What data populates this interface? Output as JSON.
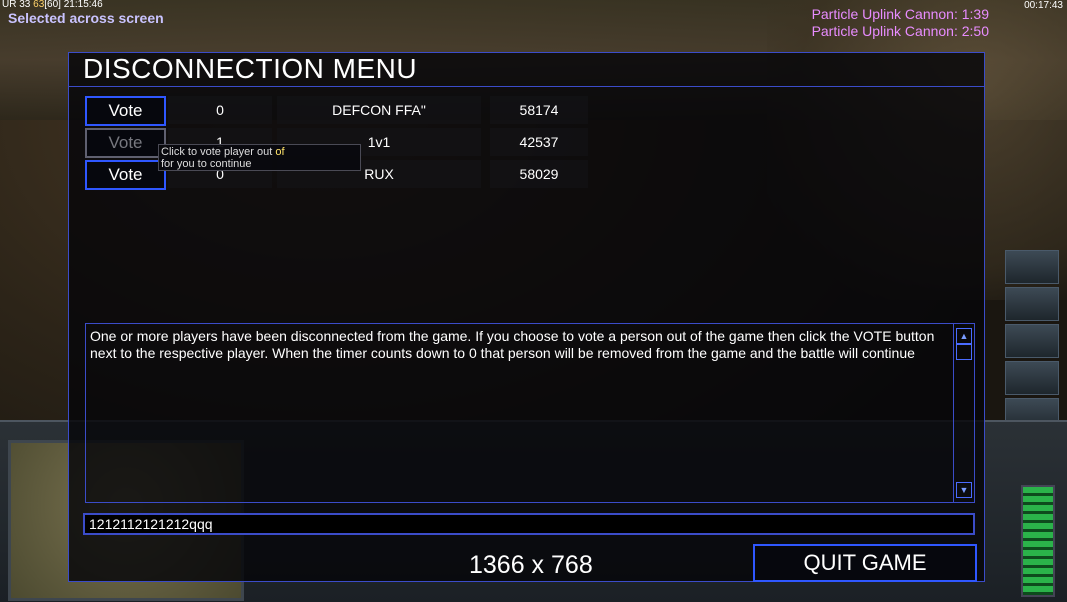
{
  "hud": {
    "stats_label": "UR",
    "stats_a": "33",
    "stats_b": "63",
    "stats_c": "[60]",
    "time": "21:15:46",
    "selection_text": "Selected across screen",
    "clock": "00:17:43",
    "timers": [
      "Particle Uplink Cannon: 1:39",
      "Particle Uplink Cannon: 2:50"
    ]
  },
  "dialog": {
    "title": "DISCONNECTION MENU",
    "players": [
      {
        "vote_label": "Vote",
        "votes": "0",
        "name": "DEFCON FFA\"",
        "ping": "58174",
        "vote_enabled": true
      },
      {
        "vote_label": "Vote",
        "votes": "1",
        "name": "1v1",
        "ping": "42537",
        "vote_enabled": false
      },
      {
        "vote_label": "Vote",
        "votes": "0",
        "name": "RUX",
        "ping": "58029",
        "vote_enabled": true
      }
    ],
    "tooltip": {
      "line1": "Click to vote player out ",
      "line1_highlight": "of",
      "line2": " for you to continue"
    },
    "message": "One or more players have been disconnected from the game. If you choose to vote a person out of the game then click the VOTE button next to the respective player. When the timer counts down to 0 that person will be removed from the game and the battle will continue",
    "chat_value": "1212112121212qqq",
    "resolution": "1366 x 768",
    "quit_label": "QUIT GAME"
  },
  "colors": {
    "accent": "#2f57ff",
    "timer": "#e88cff",
    "selection": "#c9c3ff"
  }
}
